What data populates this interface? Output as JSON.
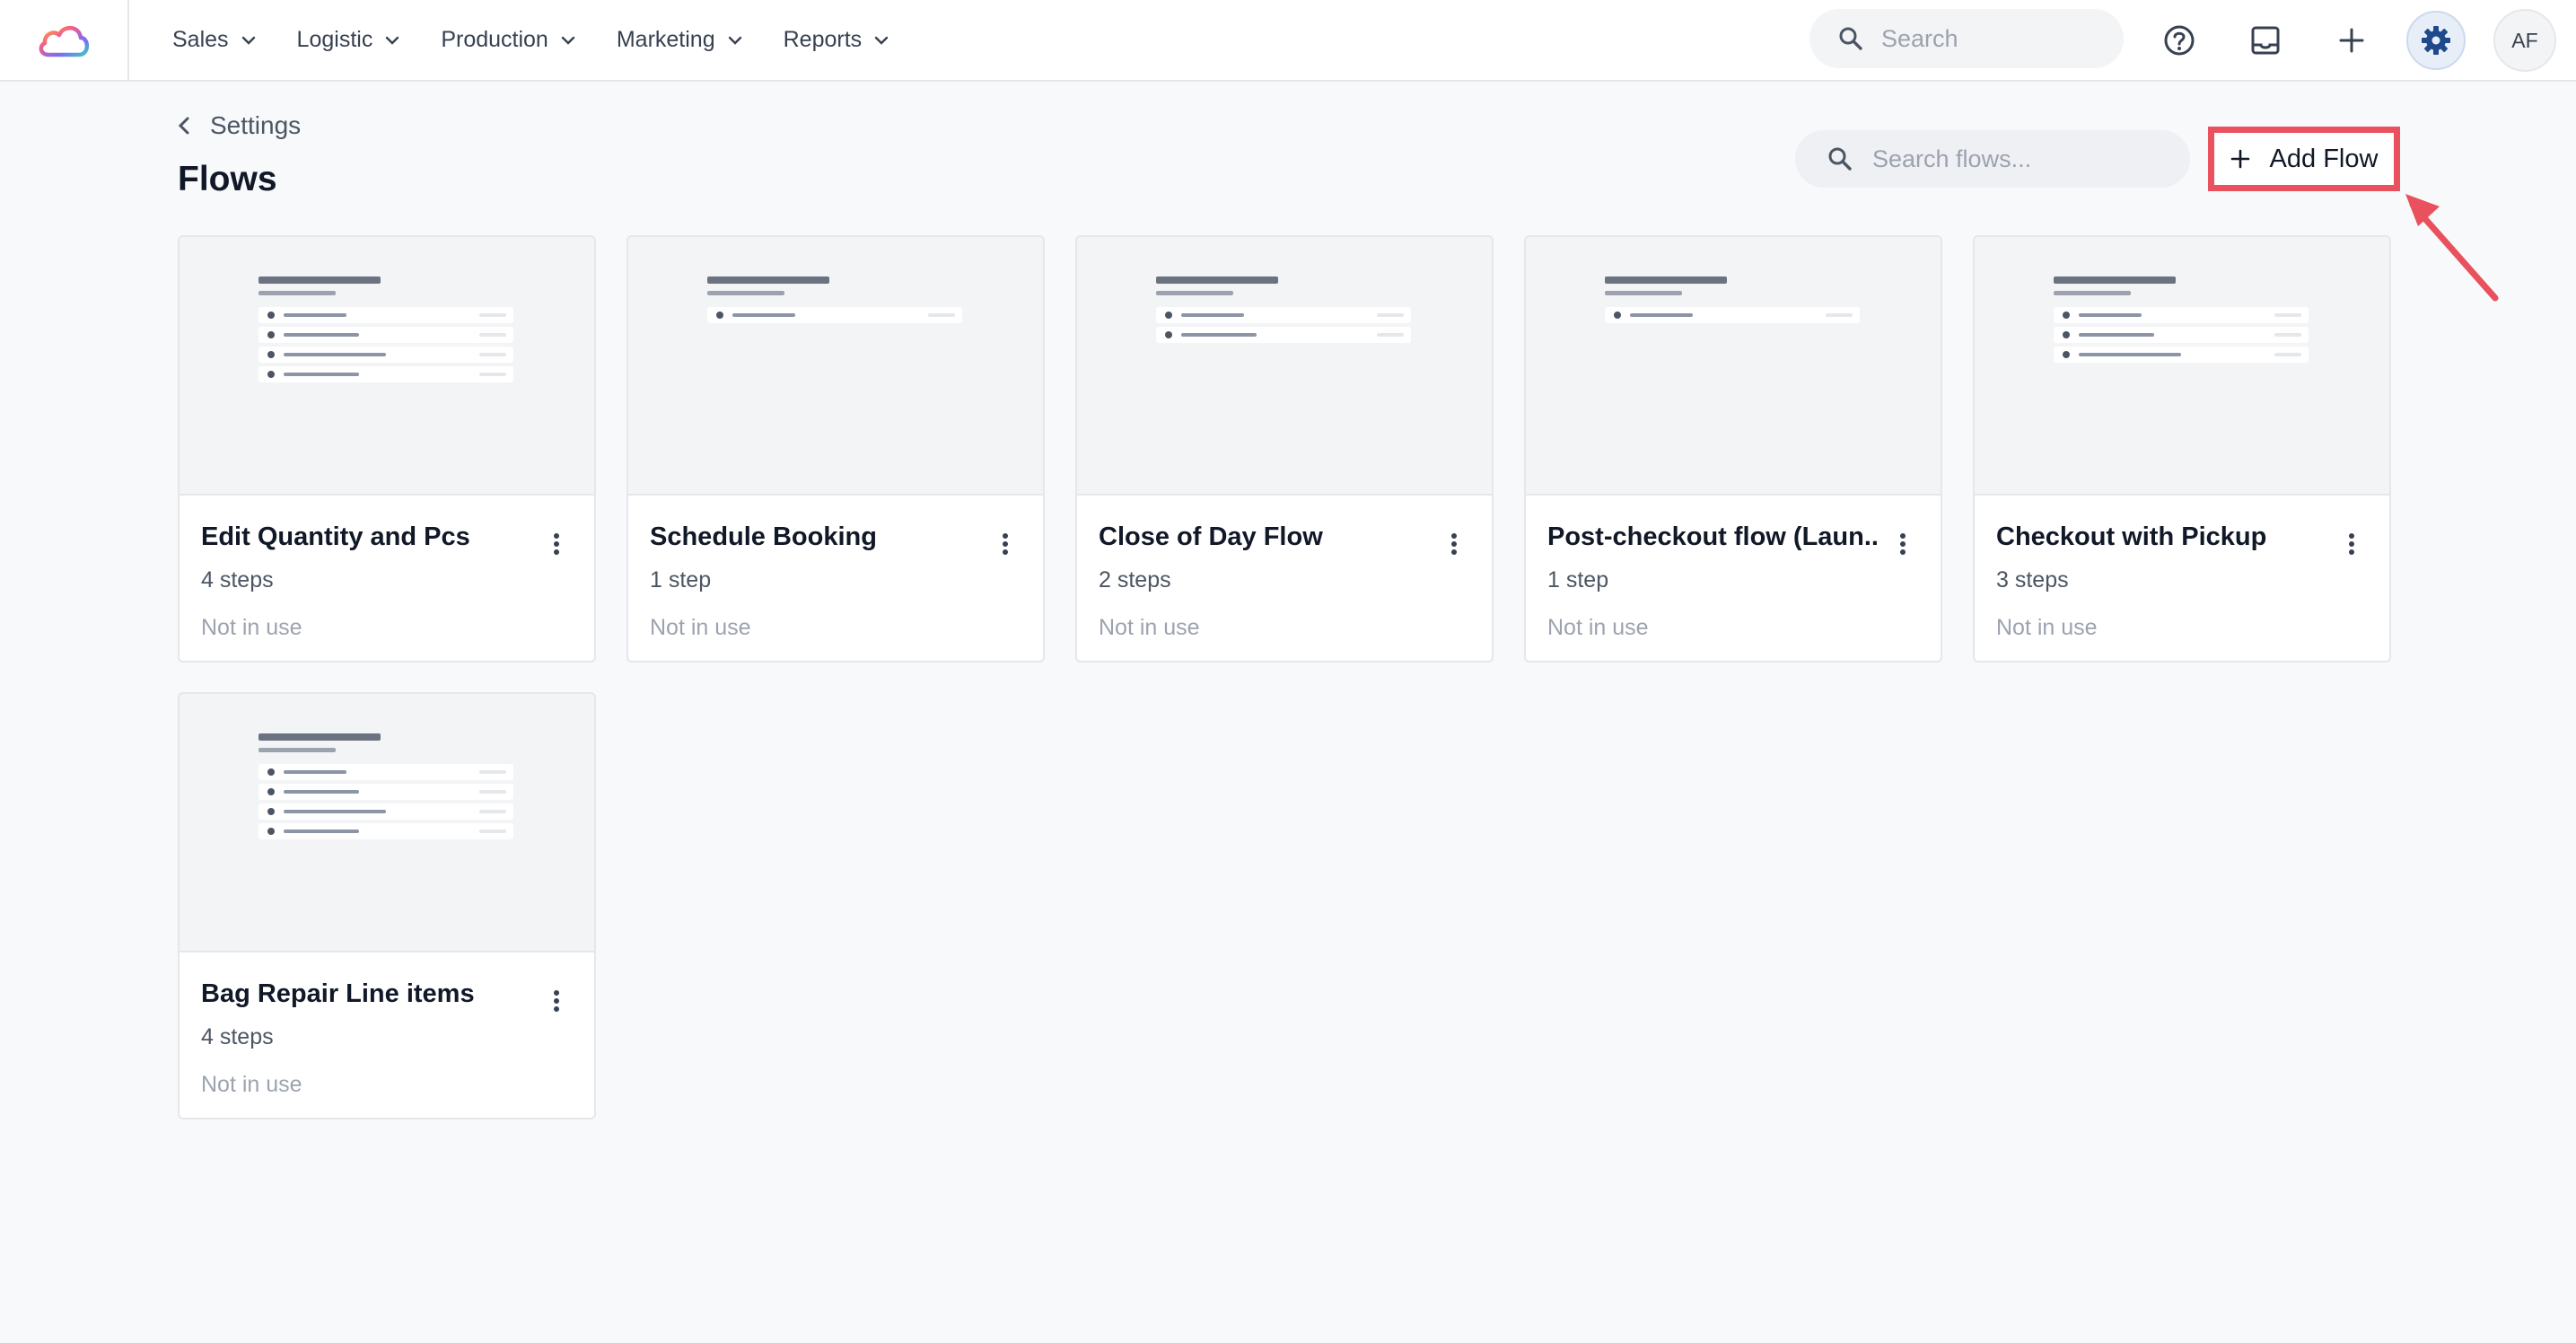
{
  "topbar": {
    "logo_icon": "cloud-logo-icon",
    "nav": [
      {
        "label": "Sales"
      },
      {
        "label": "Logistic"
      },
      {
        "label": "Production"
      },
      {
        "label": "Marketing"
      },
      {
        "label": "Reports"
      }
    ],
    "search_placeholder": "Search",
    "icons": [
      "help-icon",
      "inbox-icon",
      "plus-icon",
      "gear-icon"
    ],
    "avatar_initials": "AF"
  },
  "header": {
    "breadcrumb": "Settings",
    "title": "Flows",
    "search_placeholder": "Search flows...",
    "add_button_label": "Add Flow",
    "highlight_color": "#e8515d"
  },
  "flows": [
    {
      "name": "Edit Quantity and Pcs",
      "steps": "4 steps",
      "status": "Not in use",
      "preview_rows": 4
    },
    {
      "name": "Schedule Booking",
      "steps": "1 step",
      "status": "Not in use",
      "preview_rows": 1
    },
    {
      "name": "Close of Day Flow",
      "steps": "2 steps",
      "status": "Not in use",
      "preview_rows": 2
    },
    {
      "name": "Post-checkout flow (Laun...",
      "steps": "1 step",
      "status": "Not in use",
      "preview_rows": 1
    },
    {
      "name": "Checkout with Pickup",
      "steps": "3 steps",
      "status": "Not in use",
      "preview_rows": 3
    },
    {
      "name": "Bag Repair Line items",
      "steps": "4 steps",
      "status": "Not in use",
      "preview_rows": 4
    }
  ]
}
